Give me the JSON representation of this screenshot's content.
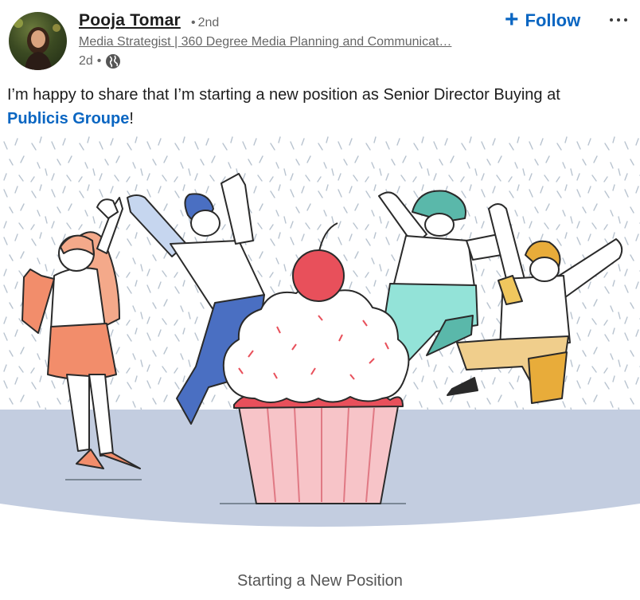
{
  "post": {
    "actor": {
      "name": "Pooja Tomar",
      "degree": "2nd",
      "headline": "Media Strategist | 360 Degree Media Planning and Communicat…",
      "time": "2d",
      "visibility_icon": "globe-icon"
    },
    "follow_label": "Follow",
    "menu_icon": "ellipsis-icon",
    "text_intro": "I’m happy to share that I’m starting a new position as Senior Director Buying at ",
    "mention": "Publicis Groupe",
    "text_end": "!",
    "media_caption": "Starting a New Position"
  },
  "colors": {
    "link": "#0a66c2",
    "secondary_text": "#666666",
    "floor": "#c3cde0",
    "cupcake_wrapper": "#f7c4c8",
    "cherry": "#e8505b"
  }
}
